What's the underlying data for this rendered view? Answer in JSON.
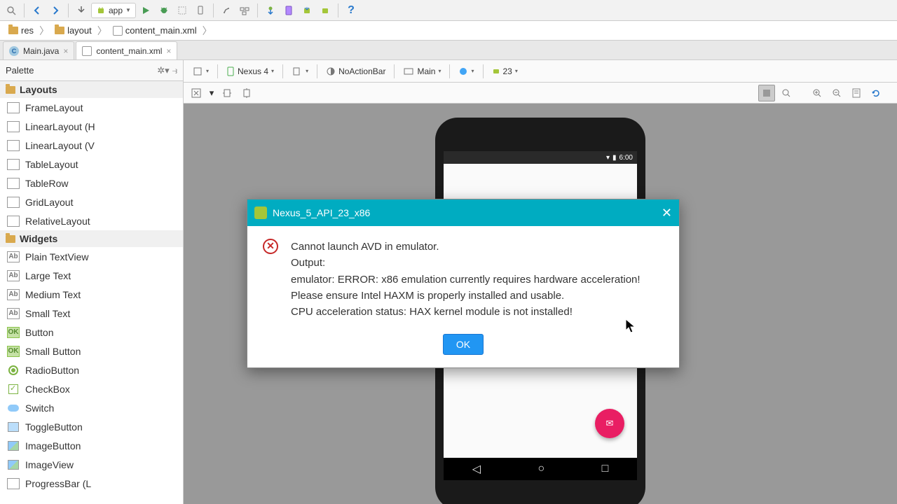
{
  "toolbar": {
    "run_config": "app"
  },
  "breadcrumb": {
    "items": [
      "res",
      "layout",
      "content_main.xml"
    ]
  },
  "tabs": [
    {
      "label": "Main.java",
      "icon": "java"
    },
    {
      "label": "content_main.xml",
      "icon": "xml",
      "active": true
    }
  ],
  "palette": {
    "title": "Palette",
    "groups": [
      {
        "name": "Layouts",
        "items": [
          "FrameLayout",
          "LinearLayout (H",
          "LinearLayout (V",
          "TableLayout",
          "TableRow",
          "GridLayout",
          "RelativeLayout"
        ]
      },
      {
        "name": "Widgets",
        "items": [
          "Plain TextView",
          "Large Text",
          "Medium Text",
          "Small Text",
          "Button",
          "Small Button",
          "RadioButton",
          "CheckBox",
          "Switch",
          "ToggleButton",
          "ImageButton",
          "ImageView",
          "ProgressBar (L"
        ]
      }
    ]
  },
  "design_toolbar": {
    "device": "Nexus 4",
    "theme": "NoActionBar",
    "activity": "Main",
    "api": "23"
  },
  "phone": {
    "time": "6:00"
  },
  "dialog": {
    "title": "Nexus_5_API_23_x86",
    "line1": "Cannot launch AVD in emulator.",
    "line2": "Output:",
    "line3": "emulator: ERROR: x86 emulation currently requires hardware acceleration!",
    "line4": "Please ensure Intel HAXM is properly installed and usable.",
    "line5": "CPU acceleration status: HAX kernel module is not installed!",
    "ok": "OK"
  }
}
